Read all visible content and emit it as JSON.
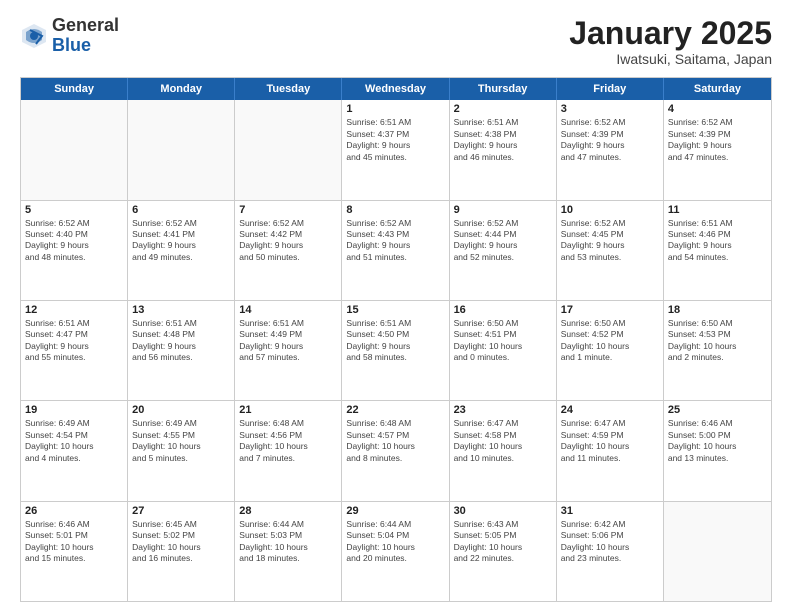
{
  "header": {
    "logo": {
      "general": "General",
      "blue": "Blue"
    },
    "title": "January 2025",
    "subtitle": "Iwatsuki, Saitama, Japan"
  },
  "weekdays": [
    "Sunday",
    "Monday",
    "Tuesday",
    "Wednesday",
    "Thursday",
    "Friday",
    "Saturday"
  ],
  "rows": [
    [
      {
        "day": "",
        "empty": true
      },
      {
        "day": "",
        "empty": true
      },
      {
        "day": "",
        "empty": true
      },
      {
        "day": "1",
        "info": "Sunrise: 6:51 AM\nSunset: 4:37 PM\nDaylight: 9 hours\nand 45 minutes."
      },
      {
        "day": "2",
        "info": "Sunrise: 6:51 AM\nSunset: 4:38 PM\nDaylight: 9 hours\nand 46 minutes."
      },
      {
        "day": "3",
        "info": "Sunrise: 6:52 AM\nSunset: 4:39 PM\nDaylight: 9 hours\nand 47 minutes."
      },
      {
        "day": "4",
        "info": "Sunrise: 6:52 AM\nSunset: 4:39 PM\nDaylight: 9 hours\nand 47 minutes."
      }
    ],
    [
      {
        "day": "5",
        "info": "Sunrise: 6:52 AM\nSunset: 4:40 PM\nDaylight: 9 hours\nand 48 minutes."
      },
      {
        "day": "6",
        "info": "Sunrise: 6:52 AM\nSunset: 4:41 PM\nDaylight: 9 hours\nand 49 minutes."
      },
      {
        "day": "7",
        "info": "Sunrise: 6:52 AM\nSunset: 4:42 PM\nDaylight: 9 hours\nand 50 minutes."
      },
      {
        "day": "8",
        "info": "Sunrise: 6:52 AM\nSunset: 4:43 PM\nDaylight: 9 hours\nand 51 minutes."
      },
      {
        "day": "9",
        "info": "Sunrise: 6:52 AM\nSunset: 4:44 PM\nDaylight: 9 hours\nand 52 minutes."
      },
      {
        "day": "10",
        "info": "Sunrise: 6:52 AM\nSunset: 4:45 PM\nDaylight: 9 hours\nand 53 minutes."
      },
      {
        "day": "11",
        "info": "Sunrise: 6:51 AM\nSunset: 4:46 PM\nDaylight: 9 hours\nand 54 minutes."
      }
    ],
    [
      {
        "day": "12",
        "info": "Sunrise: 6:51 AM\nSunset: 4:47 PM\nDaylight: 9 hours\nand 55 minutes."
      },
      {
        "day": "13",
        "info": "Sunrise: 6:51 AM\nSunset: 4:48 PM\nDaylight: 9 hours\nand 56 minutes."
      },
      {
        "day": "14",
        "info": "Sunrise: 6:51 AM\nSunset: 4:49 PM\nDaylight: 9 hours\nand 57 minutes."
      },
      {
        "day": "15",
        "info": "Sunrise: 6:51 AM\nSunset: 4:50 PM\nDaylight: 9 hours\nand 58 minutes."
      },
      {
        "day": "16",
        "info": "Sunrise: 6:50 AM\nSunset: 4:51 PM\nDaylight: 10 hours\nand 0 minutes."
      },
      {
        "day": "17",
        "info": "Sunrise: 6:50 AM\nSunset: 4:52 PM\nDaylight: 10 hours\nand 1 minute."
      },
      {
        "day": "18",
        "info": "Sunrise: 6:50 AM\nSunset: 4:53 PM\nDaylight: 10 hours\nand 2 minutes."
      }
    ],
    [
      {
        "day": "19",
        "info": "Sunrise: 6:49 AM\nSunset: 4:54 PM\nDaylight: 10 hours\nand 4 minutes."
      },
      {
        "day": "20",
        "info": "Sunrise: 6:49 AM\nSunset: 4:55 PM\nDaylight: 10 hours\nand 5 minutes."
      },
      {
        "day": "21",
        "info": "Sunrise: 6:48 AM\nSunset: 4:56 PM\nDaylight: 10 hours\nand 7 minutes."
      },
      {
        "day": "22",
        "info": "Sunrise: 6:48 AM\nSunset: 4:57 PM\nDaylight: 10 hours\nand 8 minutes."
      },
      {
        "day": "23",
        "info": "Sunrise: 6:47 AM\nSunset: 4:58 PM\nDaylight: 10 hours\nand 10 minutes."
      },
      {
        "day": "24",
        "info": "Sunrise: 6:47 AM\nSunset: 4:59 PM\nDaylight: 10 hours\nand 11 minutes."
      },
      {
        "day": "25",
        "info": "Sunrise: 6:46 AM\nSunset: 5:00 PM\nDaylight: 10 hours\nand 13 minutes."
      }
    ],
    [
      {
        "day": "26",
        "info": "Sunrise: 6:46 AM\nSunset: 5:01 PM\nDaylight: 10 hours\nand 15 minutes."
      },
      {
        "day": "27",
        "info": "Sunrise: 6:45 AM\nSunset: 5:02 PM\nDaylight: 10 hours\nand 16 minutes."
      },
      {
        "day": "28",
        "info": "Sunrise: 6:44 AM\nSunset: 5:03 PM\nDaylight: 10 hours\nand 18 minutes."
      },
      {
        "day": "29",
        "info": "Sunrise: 6:44 AM\nSunset: 5:04 PM\nDaylight: 10 hours\nand 20 minutes."
      },
      {
        "day": "30",
        "info": "Sunrise: 6:43 AM\nSunset: 5:05 PM\nDaylight: 10 hours\nand 22 minutes."
      },
      {
        "day": "31",
        "info": "Sunrise: 6:42 AM\nSunset: 5:06 PM\nDaylight: 10 hours\nand 23 minutes."
      },
      {
        "day": "",
        "empty": true
      }
    ]
  ]
}
